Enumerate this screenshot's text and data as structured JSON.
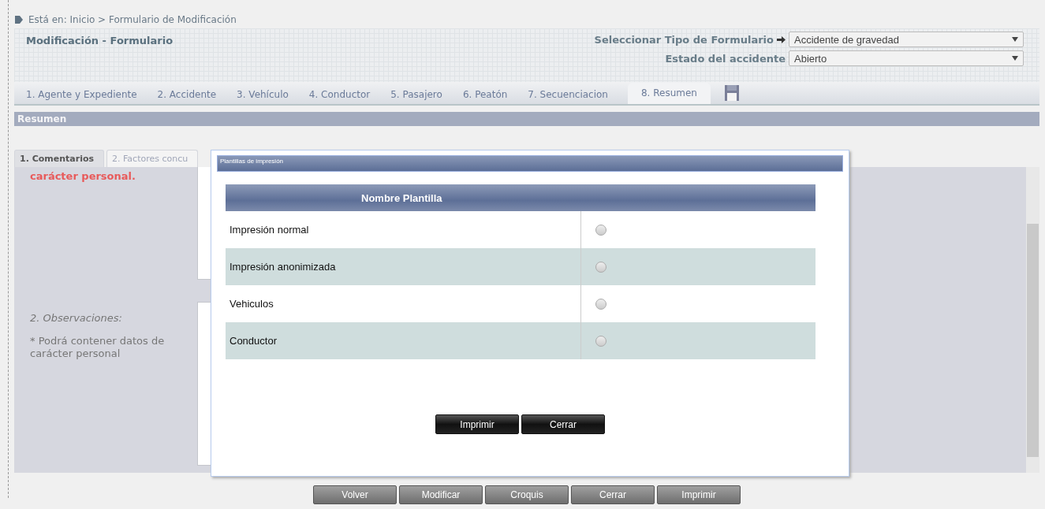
{
  "breadcrumb": "Está en: Inicio > Formulario de Modificación",
  "header": {
    "title": "Modificación - Formulario",
    "fields": [
      {
        "kind": "arrow",
        "label": "Seleccionar Tipo de Formulario",
        "value": "Accidente de gravedad"
      },
      {
        "kind": "plain",
        "label": "Estado del accidente",
        "value": "Abierto"
      }
    ]
  },
  "tabs": [
    {
      "label": "1. Agente y Expediente",
      "selected": false
    },
    {
      "label": "2. Accidente",
      "selected": false
    },
    {
      "label": "3. Vehículo",
      "selected": false
    },
    {
      "label": "4. Conductor",
      "selected": false
    },
    {
      "label": "5. Pasajero",
      "selected": false
    },
    {
      "label": "6. Peatón",
      "selected": false
    },
    {
      "label": "7. Secuenciacion",
      "selected": false
    },
    {
      "label": "8. Resumen",
      "selected": true
    }
  ],
  "section_title": "Resumen",
  "subtabs": [
    {
      "label": "1. Comentarios",
      "selected": true
    },
    {
      "label": "2. Factores concu",
      "selected": false
    }
  ],
  "comments": {
    "warning": "carácter personal.",
    "observations_label": "2. Observaciones:",
    "observations_note": "* Podrá contener datos de carácter personal"
  },
  "buttons": [
    "Volver",
    "Modificar",
    "Croquis",
    "Cerrar",
    "Imprimir"
  ],
  "modal": {
    "title": "Plantillas de impresión",
    "column": "Nombre Plantilla",
    "rows": [
      {
        "name": "Impresión normal",
        "selected": false
      },
      {
        "name": "Impresión anonimizada",
        "selected": false
      },
      {
        "name": "Vehiculos",
        "selected": false
      },
      {
        "name": "Conductor",
        "selected": false
      }
    ],
    "buttons": [
      "Imprimir",
      "Cerrar"
    ]
  }
}
